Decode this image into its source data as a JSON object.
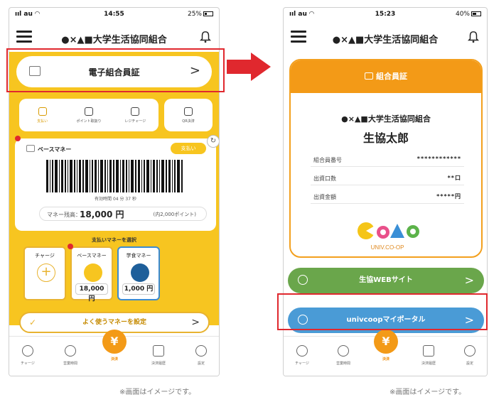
{
  "colors": {
    "accent_yellow": "#f7c520",
    "accent_orange": "#f39a17",
    "highlight_red": "#e0282e",
    "web_green": "#6aa64b",
    "portal_blue": "#4a9bd6"
  },
  "before": {
    "status": {
      "carrier": "au",
      "time": "14:55",
      "battery": "25%"
    },
    "header": {
      "title": "●×▲■大学生活協同組合"
    },
    "member_card_button": {
      "label": "電子組合員証"
    },
    "quick_actions": [
      {
        "label": "支払い",
        "icon": "pay-icon"
      },
      {
        "label": "ポイント取扱り",
        "icon": "point-icon"
      },
      {
        "label": "レジチャージ",
        "icon": "register-charge-icon"
      }
    ],
    "qr_action": {
      "label": "QR決済",
      "icon": "camera-icon"
    },
    "payment_card": {
      "money_label": "ベースマネー",
      "pay_button": "支払い",
      "valid_time": "有効時間 04 分 37 秒",
      "balance_label": "マネー残高：",
      "balance_value": "18,000 円",
      "points": "(内2,000ポイント)"
    },
    "money_select_title": "支払いマネーを選択",
    "money_options": [
      {
        "title": "チャージ",
        "value": ""
      },
      {
        "title": "ベースマネー",
        "value": "18,000 円"
      },
      {
        "title": "学食マネー",
        "value": "1,000 円"
      }
    ],
    "favorite_button": "よく使うマネーを設定",
    "tabs": [
      {
        "label": "チャージ"
      },
      {
        "label": "営業時間"
      },
      {
        "label": "決済",
        "glyph": "¥"
      },
      {
        "label": "決済履歴"
      },
      {
        "label": "設定"
      }
    ],
    "caption": "※画面はイメージです。"
  },
  "after": {
    "status": {
      "carrier": "au",
      "time": "15:23",
      "battery": "40%"
    },
    "header": {
      "title": "●×▲■大学生活協同組合"
    },
    "card_caption": "組合員証",
    "org_name": "●×▲■大学生活協同組合",
    "member_name": "生協太郎",
    "info_rows": [
      {
        "key": "組合員番号",
        "value": "************"
      },
      {
        "key": "出資口数",
        "value": "**口"
      },
      {
        "key": "出資金額",
        "value": "*****円"
      }
    ],
    "logo_text": "UNIV.CO-OP",
    "links": {
      "web": "生協WEBサイト",
      "portal": "univcoopマイポータル"
    },
    "tabs": [
      {
        "label": "チャージ"
      },
      {
        "label": "営業時間"
      },
      {
        "label": "決済",
        "glyph": "¥"
      },
      {
        "label": "決済履歴"
      },
      {
        "label": "設定"
      }
    ],
    "caption": "※画面はイメージです。"
  }
}
